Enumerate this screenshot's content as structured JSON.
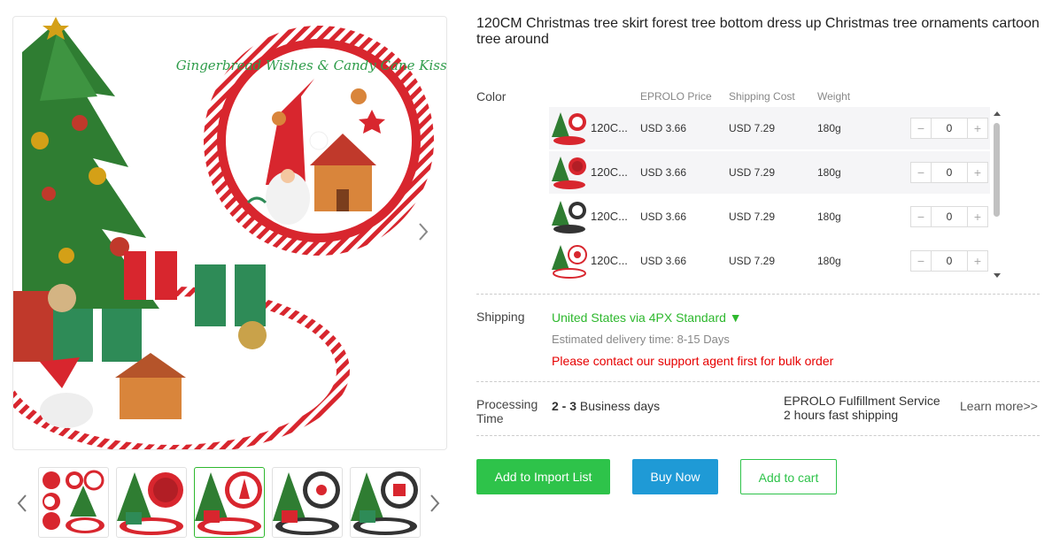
{
  "product": {
    "title": "120CM Christmas tree skirt forest tree bottom dress up Christmas tree ornaments cartoon tree around",
    "main_image_text": "Gingerbread Wishes & Candy Cane Kisses"
  },
  "variants": {
    "label": "Color",
    "headers": {
      "price": "EPROLO Price",
      "shipping": "Shipping Cost",
      "weight": "Weight"
    },
    "rows": [
      {
        "name": "120C...",
        "price": "USD 3.66",
        "shipping": "USD 7.29",
        "weight": "180g",
        "qty": "0"
      },
      {
        "name": "120C...",
        "price": "USD 3.66",
        "shipping": "USD 7.29",
        "weight": "180g",
        "qty": "0"
      },
      {
        "name": "120C...",
        "price": "USD 3.66",
        "shipping": "USD 7.29",
        "weight": "180g",
        "qty": "0"
      },
      {
        "name": "120C...",
        "price": "USD 3.66",
        "shipping": "USD 7.29",
        "weight": "180g",
        "qty": "0"
      }
    ],
    "minus": "−",
    "plus": "+"
  },
  "shipping": {
    "label": "Shipping",
    "method": "United States via 4PX Standard ▼",
    "estimated": "Estimated delivery time: 8-15 Days",
    "bulk_note": "Please contact our support agent first for bulk order"
  },
  "processing": {
    "label_line1": "Processing",
    "label_line2": "Time",
    "days_bold": "2 - 3",
    "days_text": "Business days",
    "service_line1": "EPROLO Fulfillment Service",
    "service_line2": "2 hours fast shipping",
    "learn_more": "Learn more>>"
  },
  "buttons": {
    "add_import": "Add to Import List",
    "buy_now": "Buy Now",
    "add_cart": "Add to cart"
  },
  "colors": {
    "green": "#2ec34a",
    "blue": "#1f9ad6",
    "red_alert": "#e60000",
    "skirt_red": "#d8262e",
    "tree_green": "#2f7d32"
  }
}
